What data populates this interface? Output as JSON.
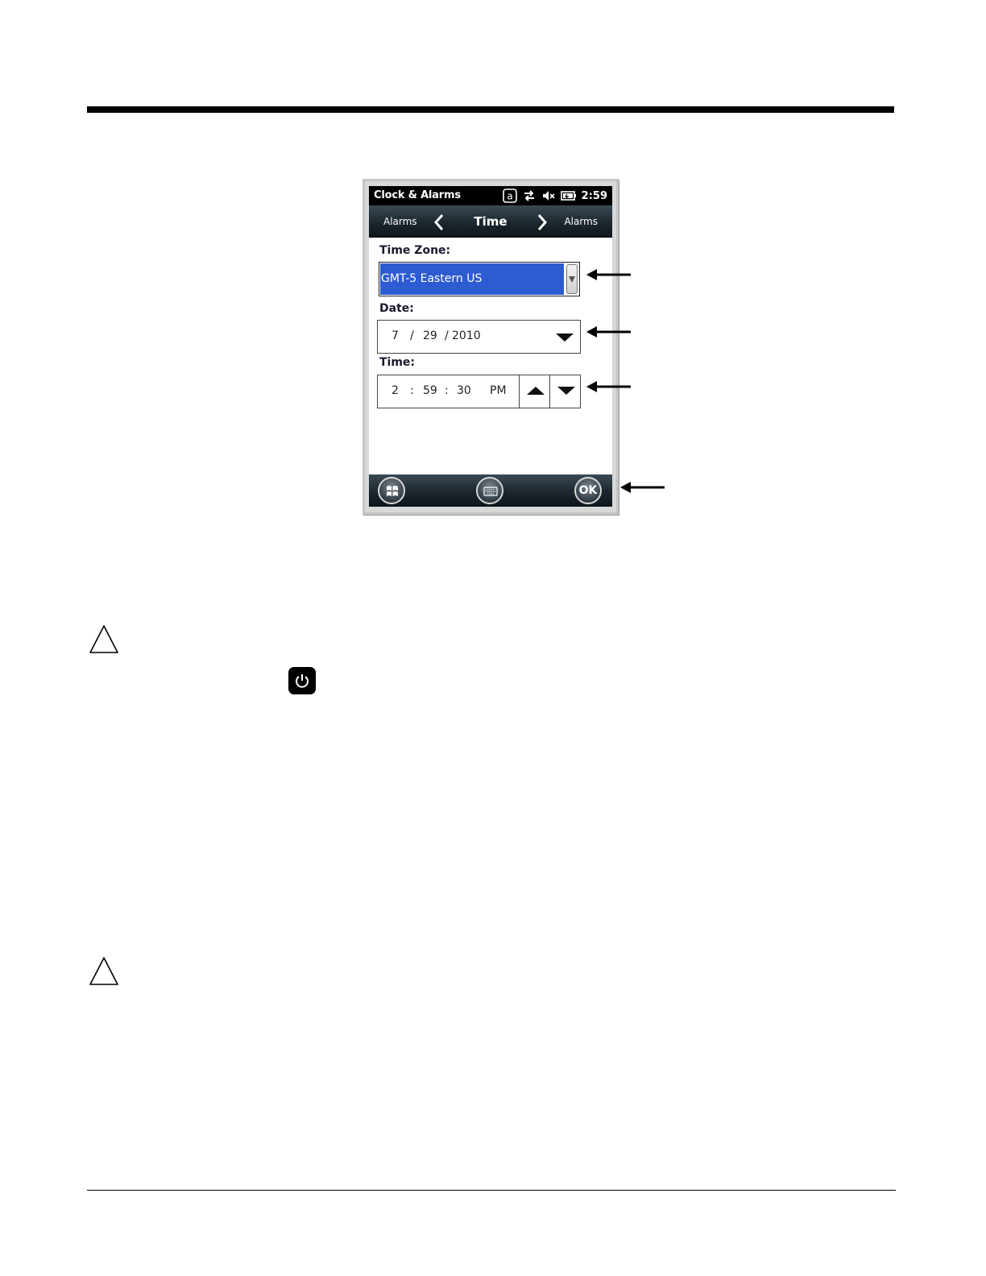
{
  "device": {
    "status_bar": {
      "title": "Clock & Alarms",
      "clock": "2:59"
    },
    "nav": {
      "left": "Alarms",
      "center": "Time",
      "right": "Alarms"
    },
    "time_zone": {
      "label": "Time Zone:",
      "value": "GMT-5 Eastern US"
    },
    "date": {
      "label": "Date:",
      "month": "7",
      "sep1": "/",
      "day": "29",
      "sep2": "/",
      "year": "2010"
    },
    "time": {
      "label": "Time:",
      "hour": "2",
      "sep1": ":",
      "minute": "59",
      "sep2": ":",
      "second": "30",
      "ampm": "PM"
    },
    "softkeys": {
      "ok": "OK"
    }
  },
  "icons": [
    "at-icon",
    "sync-icon",
    "speaker-muted-icon",
    "battery-icon",
    "chevron-left-icon",
    "chevron-right-icon",
    "dropdown-arrow-icon",
    "spin-up-icon",
    "spin-down-icon",
    "windows-start-icon",
    "keyboard-icon",
    "caution-icon",
    "power-key-icon"
  ]
}
